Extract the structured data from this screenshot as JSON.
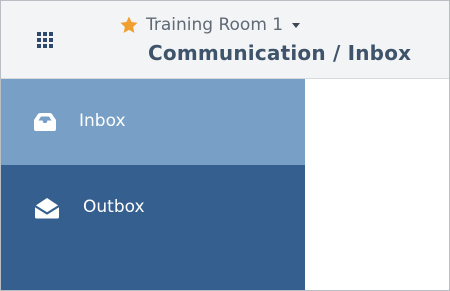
{
  "header": {
    "app_menu_icon": "grid-icon",
    "room": {
      "favorite_icon": "star-icon",
      "name": "Training Room 1",
      "dropdown_icon": "caret-down-icon"
    },
    "page_title": "Communication / Inbox"
  },
  "sidebar": {
    "items": [
      {
        "label": "Inbox",
        "icon": "inbox-tray-icon",
        "active": true
      },
      {
        "label": "Outbox",
        "icon": "envelope-open-icon",
        "active": false
      }
    ]
  },
  "colors": {
    "header_bg": "#f3f4f5",
    "sidebar_bg": "#345f8f",
    "sidebar_active_bg": "#789fc5",
    "title_text": "#3f536a",
    "star": "#f0a030"
  }
}
